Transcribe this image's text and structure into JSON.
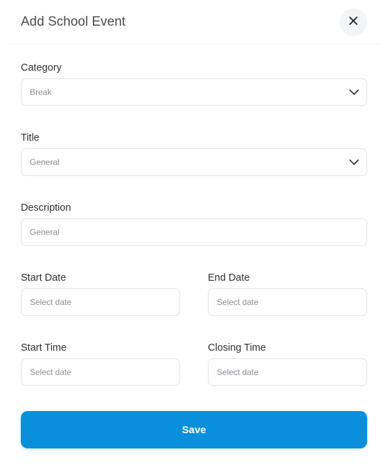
{
  "header": {
    "title": "Add School Event",
    "close_icon": "close-icon"
  },
  "form": {
    "category": {
      "label": "Category",
      "value": "Break",
      "icon": "chevron-down-icon"
    },
    "title": {
      "label": "Title",
      "value": "General",
      "icon": "chevron-down-icon"
    },
    "description": {
      "label": "Description",
      "value": "General"
    },
    "start_date": {
      "label": "Start Date",
      "placeholder": "Select date"
    },
    "end_date": {
      "label": "End Date",
      "placeholder": "Select date"
    },
    "start_time": {
      "label": "Start Time",
      "placeholder": "Select date"
    },
    "closing_time": {
      "label": "Closing Time",
      "placeholder": "Select date"
    }
  },
  "actions": {
    "save_label": "Save"
  },
  "colors": {
    "primary": "#0a8fdc",
    "border": "#e2e4e8",
    "text": "#2f2f33",
    "muted": "#8a8d93"
  }
}
